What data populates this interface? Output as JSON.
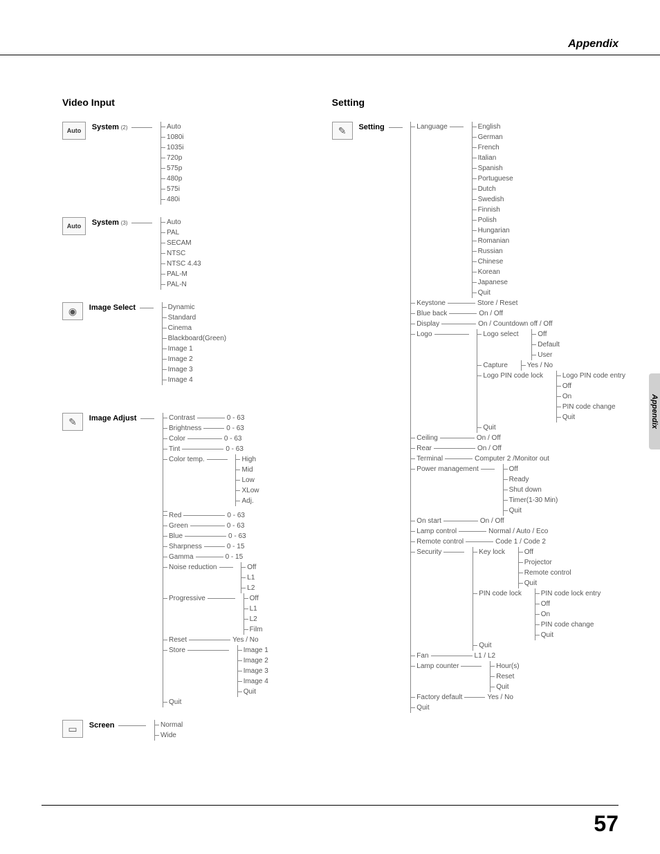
{
  "header": {
    "section": "Appendix"
  },
  "sidetab": "Appendix",
  "page_number": "57",
  "video_input": {
    "title": "Video Input",
    "system2": {
      "label": "System",
      "note": "(2)",
      "box": "Auto",
      "items": [
        "Auto",
        "1080i",
        "1035i",
        "720p",
        "575p",
        "480p",
        "575i",
        "480i"
      ]
    },
    "system3": {
      "label": "System",
      "note": "(3)",
      "box": "Auto",
      "items": [
        "Auto",
        "PAL",
        "SECAM",
        "NTSC",
        "NTSC 4.43",
        "PAL-M",
        "PAL-N"
      ]
    },
    "image_select": {
      "label": "Image Select",
      "items": [
        "Dynamic",
        "Standard",
        "Cinema",
        "Blackboard(Green)",
        "Image 1",
        "Image 2",
        "Image 3",
        "Image 4"
      ]
    },
    "image_adjust": {
      "label": "Image Adjust",
      "ranges": [
        {
          "n": "Contrast",
          "v": "0 - 63"
        },
        {
          "n": "Brightness",
          "v": "0 - 63"
        },
        {
          "n": "Color",
          "v": "0 - 63"
        },
        {
          "n": "Tint",
          "v": "0 - 63"
        }
      ],
      "color_temp": {
        "n": "Color temp.",
        "items": [
          "High",
          "Mid",
          "Low",
          "XLow",
          "Adj."
        ]
      },
      "rgb": [
        {
          "n": "Red",
          "v": "0 - 63"
        },
        {
          "n": "Green",
          "v": "0 - 63"
        },
        {
          "n": "Blue",
          "v": "0 - 63"
        },
        {
          "n": "Sharpness",
          "v": "0 - 15"
        },
        {
          "n": "Gamma",
          "v": "0 - 15"
        }
      ],
      "noise": {
        "n": "Noise reduction",
        "items": [
          "Off",
          "L1",
          "L2"
        ]
      },
      "progressive": {
        "n": "Progressive",
        "items": [
          "Off",
          "L1",
          "L2",
          "Film"
        ]
      },
      "reset": {
        "n": "Reset",
        "v": "Yes / No"
      },
      "store": {
        "n": "Store",
        "items": [
          "Image 1",
          "Image 2",
          "Image 3",
          "Image 4",
          "Quit"
        ]
      },
      "quit": "Quit"
    },
    "screen": {
      "label": "Screen",
      "items": [
        "Normal",
        "Wide"
      ]
    }
  },
  "setting": {
    "title": "Setting",
    "root": "Setting",
    "language": {
      "n": "Language",
      "items": [
        "English",
        "German",
        "French",
        "Italian",
        "Spanish",
        "Portuguese",
        "Dutch",
        "Swedish",
        "Finnish",
        "Polish",
        "Hungarian",
        "Romanian",
        "Russian",
        "Chinese",
        "Korean",
        "Japanese",
        "Quit"
      ]
    },
    "keystone": {
      "n": "Keystone",
      "v": "Store / Reset"
    },
    "blueback": {
      "n": "Blue back",
      "v": "On / Off"
    },
    "display": {
      "n": "Display",
      "v": "On / Countdown off / Off"
    },
    "logo": {
      "n": "Logo",
      "logo_select": {
        "n": "Logo select",
        "items": [
          "Off",
          "Default",
          "User"
        ]
      },
      "capture": {
        "n": "Capture",
        "v": "Yes / No"
      },
      "pin_lock": {
        "n": "Logo PIN code lock",
        "items": [
          "Logo PIN code entry",
          "Off",
          "On",
          "PIN code change",
          "Quit"
        ]
      },
      "quit": "Quit"
    },
    "ceiling": {
      "n": "Ceiling",
      "v": "On / Off"
    },
    "rear": {
      "n": "Rear",
      "v": "On / Off"
    },
    "terminal": {
      "n": "Terminal",
      "v": "Computer 2 /Monitor out"
    },
    "power_mgmt": {
      "n": "Power management",
      "items": [
        "Off",
        "Ready",
        "Shut down",
        "Timer(1-30 Min)",
        "Quit"
      ]
    },
    "on_start": {
      "n": "On start",
      "v": "On / Off"
    },
    "lamp_control": {
      "n": "Lamp control",
      "v": "Normal / Auto / Eco"
    },
    "remote": {
      "n": "Remote control",
      "v": "Code 1 / Code 2"
    },
    "security": {
      "n": "Security",
      "keylock": {
        "n": "Key lock",
        "items": [
          "Off",
          "Projector",
          "Remote control",
          "Quit"
        ]
      },
      "pinlock": {
        "n": "PIN code lock",
        "items": [
          "PIN code lock entry",
          "Off",
          "On",
          "PIN code change",
          "Quit"
        ]
      },
      "quit": "Quit"
    },
    "fan": {
      "n": "Fan",
      "v": "L1 / L2"
    },
    "lamp_counter": {
      "n": "Lamp counter",
      "items": [
        "Hour(s)",
        "Reset",
        "Quit"
      ]
    },
    "factory": {
      "n": "Factory default",
      "v": "Yes / No"
    },
    "quit": "Quit"
  }
}
